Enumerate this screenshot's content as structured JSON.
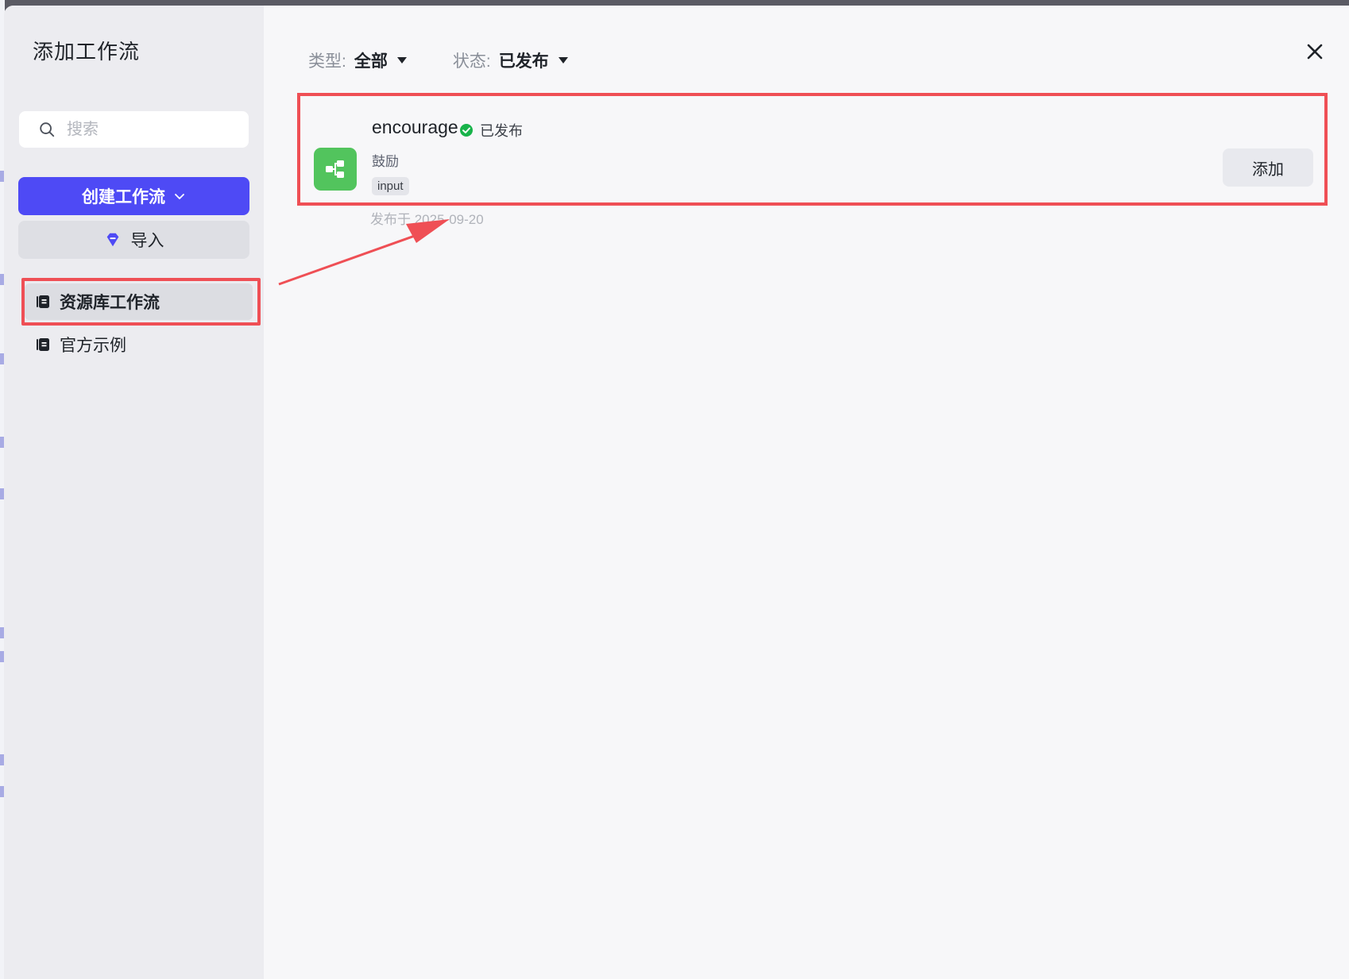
{
  "dialog": {
    "title": "添加工作流",
    "close_icon": "close-icon"
  },
  "sidebar": {
    "search": {
      "placeholder": "搜索",
      "value": ""
    },
    "create_button": "创建工作流",
    "import_button": "导入",
    "nav": [
      {
        "label": "资源库工作流",
        "active": true
      },
      {
        "label": "官方示例",
        "active": false
      }
    ]
  },
  "filters": {
    "type": {
      "label": "类型:",
      "value": "全部"
    },
    "status": {
      "label": "状态:",
      "value": "已发布"
    }
  },
  "workflows": [
    {
      "name": "encourage",
      "status": "已发布",
      "description": "鼓励",
      "tag": "input",
      "published": "发布于 2025-09-20",
      "add_label": "添加"
    }
  ],
  "colors": {
    "accent": "#4e4af5",
    "highlight": "#ef4f55",
    "workflow_icon": "#52c45d",
    "status_ok": "#18b34a"
  }
}
